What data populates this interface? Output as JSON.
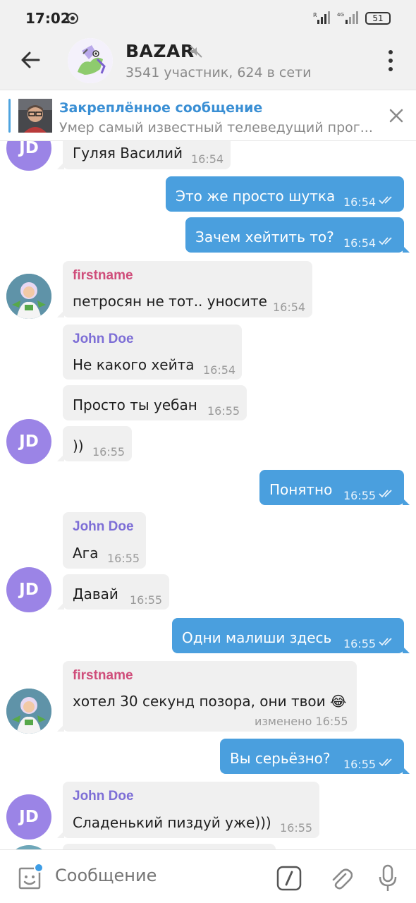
{
  "status_bar": {
    "time": "17:02",
    "battery": "51"
  },
  "header": {
    "title": "BAZAR",
    "subtitle": "3541 участник, 624 в сети"
  },
  "pinned": {
    "title": "Закреплённое сообщение",
    "text": "Умер самый известный телеведущий прог..."
  },
  "messages": [
    {
      "id": "m1",
      "direction": "in",
      "text": "Гуляя Василий",
      "time": "16:54"
    },
    {
      "id": "m2",
      "direction": "out",
      "text": "Это же просто шутка",
      "time": "16:54"
    },
    {
      "id": "m3",
      "direction": "out",
      "text": "Зачем хейтить то?",
      "time": "16:54"
    },
    {
      "id": "m4",
      "direction": "in",
      "sender": "firstname",
      "text": "петросян не тот.. уносите",
      "time": "16:54"
    },
    {
      "id": "m5",
      "direction": "in",
      "sender": "John Doe",
      "text": "Не какого хейта",
      "time": "16:54"
    },
    {
      "id": "m6",
      "direction": "in",
      "text": "Просто ты уебан",
      "time": "16:55"
    },
    {
      "id": "m7",
      "direction": "in",
      "text": "))",
      "time": "16:55"
    },
    {
      "id": "m8",
      "direction": "out",
      "text": "Понятно",
      "time": "16:55"
    },
    {
      "id": "m9",
      "direction": "in",
      "sender": "John Doe",
      "text": "Ага",
      "time": "16:55"
    },
    {
      "id": "m10",
      "direction": "in",
      "text": "Давай",
      "time": "16:55"
    },
    {
      "id": "m11",
      "direction": "out",
      "text": "Одни малиши здесь",
      "time": "16:55"
    },
    {
      "id": "m12",
      "direction": "in",
      "sender": "firstname",
      "text": "хотел 30 секунд позора, они твои 😂",
      "time": "изменено 16:55"
    },
    {
      "id": "m13",
      "direction": "out",
      "text": "Вы серьёзно?",
      "time": "16:55"
    },
    {
      "id": "m14",
      "direction": "in",
      "sender": "John Doe",
      "text": "Сладенький пиздуй уже)))",
      "time": "16:55"
    }
  ],
  "avatars": {
    "john_initials": "JD"
  },
  "composer": {
    "placeholder": "Сообщение"
  },
  "colors": {
    "outgoing_bubble": "#4a9fde",
    "incoming_bubble": "#f0f0f0",
    "sender_firstname": "#cf4d7a",
    "sender_john": "#7d6ed6",
    "avatar_jd": "#9b84e6",
    "pinned_accent": "#3a8fd4"
  }
}
